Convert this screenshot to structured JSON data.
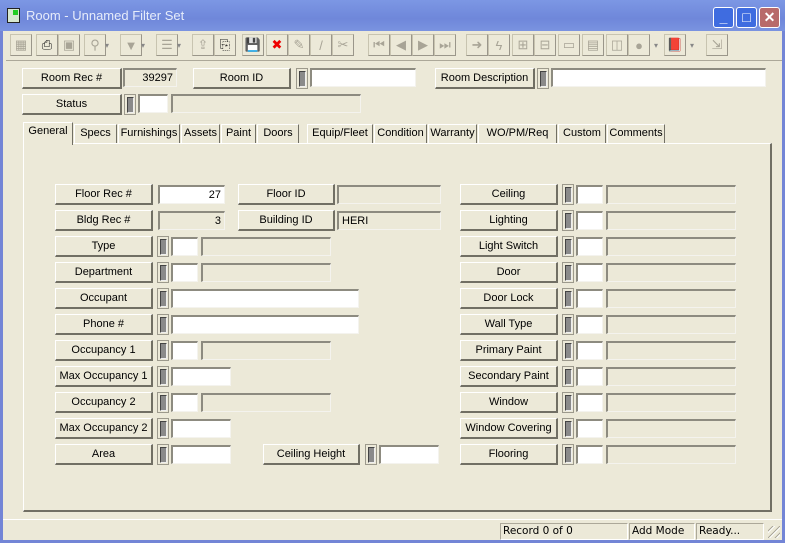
{
  "window": {
    "title": "Room - Unnamed Filter Set",
    "controls": {
      "minimize": "_",
      "maximize": "□",
      "close": "✕"
    }
  },
  "toolbar": {
    "buttons": [
      {
        "name": "select-area",
        "glyph": "▦",
        "enabled": false
      },
      {
        "name": "print",
        "glyph": "⎙",
        "enabled": true
      },
      {
        "name": "print-preview",
        "glyph": "▣",
        "enabled": false
      },
      {
        "name": "query",
        "glyph": "⚲",
        "enabled": false
      },
      {
        "name": "filter",
        "glyph": "▼",
        "enabled": false
      },
      {
        "name": "report",
        "glyph": "☰",
        "enabled": false
      },
      {
        "name": "export",
        "glyph": "⇪",
        "enabled": false
      },
      {
        "name": "new-document",
        "glyph": "⎘",
        "enabled": true
      },
      {
        "name": "save",
        "glyph": "💾",
        "enabled": true
      },
      {
        "name": "delete",
        "glyph": "✖",
        "enabled": true
      },
      {
        "name": "attach",
        "glyph": "✎",
        "enabled": false
      },
      {
        "name": "edit",
        "glyph": "/",
        "enabled": false
      },
      {
        "name": "cut",
        "glyph": "✂",
        "enabled": false
      },
      {
        "name": "first-record",
        "glyph": "⏮",
        "enabled": false
      },
      {
        "name": "previous-record",
        "glyph": "◀",
        "enabled": false
      },
      {
        "name": "next-record",
        "glyph": "▶",
        "enabled": false
      },
      {
        "name": "last-record",
        "glyph": "⏭",
        "enabled": false
      },
      {
        "name": "go-to",
        "glyph": "➜",
        "enabled": false
      },
      {
        "name": "lightning",
        "glyph": "ϟ",
        "enabled": false
      },
      {
        "name": "tree-view",
        "glyph": "⊞",
        "enabled": false
      },
      {
        "name": "hierarchy",
        "glyph": "⊟",
        "enabled": false
      },
      {
        "name": "form-view",
        "glyph": "▭",
        "enabled": false
      },
      {
        "name": "calendar",
        "glyph": "▤",
        "enabled": false
      },
      {
        "name": "chart",
        "glyph": "◫",
        "enabled": false
      },
      {
        "name": "comment",
        "glyph": "●",
        "enabled": false
      },
      {
        "name": "help-book",
        "glyph": "📕",
        "enabled": true
      },
      {
        "name": "exit",
        "glyph": "⇲",
        "enabled": false
      }
    ]
  },
  "header": {
    "room_rec": {
      "label": "Room Rec #",
      "value": "39297"
    },
    "room_id": {
      "label": "Room ID",
      "value": ""
    },
    "room_description": {
      "label": "Room Description",
      "value": ""
    },
    "status": {
      "label": "Status",
      "code": "",
      "description": ""
    }
  },
  "tabs": [
    {
      "label": "General",
      "active": true
    },
    {
      "label": "Specs"
    },
    {
      "label": "Furnishings"
    },
    {
      "label": "Assets"
    },
    {
      "label": "Paint"
    },
    {
      "label": "Doors"
    },
    {
      "label": "Equip/Fleet"
    },
    {
      "label": "Condition"
    },
    {
      "label": "Warranty"
    },
    {
      "label": "WO/PM/Req"
    },
    {
      "label": "Custom"
    },
    {
      "label": "Comments"
    }
  ],
  "general": {
    "floor_rec": {
      "label": "Floor Rec #",
      "value": "27"
    },
    "floor_id": {
      "label": "Floor ID",
      "value": ""
    },
    "bldg_rec": {
      "label": "Bldg Rec #",
      "value": "3"
    },
    "building_id": {
      "label": "Building ID",
      "value": "HERI"
    },
    "type": {
      "label": "Type",
      "code": "",
      "description": ""
    },
    "department": {
      "label": "Department",
      "code": "",
      "description": ""
    },
    "occupant": {
      "label": "Occupant",
      "value": ""
    },
    "phone": {
      "label": "Phone #",
      "value": ""
    },
    "occupancy1": {
      "label": "Occupancy 1",
      "code": "",
      "description": ""
    },
    "max_occupancy1": {
      "label": "Max Occupancy 1",
      "value": ""
    },
    "occupancy2": {
      "label": "Occupancy 2",
      "code": "",
      "description": ""
    },
    "max_occupancy2": {
      "label": "Max Occupancy 2",
      "value": ""
    },
    "area": {
      "label": "Area",
      "value": ""
    },
    "ceiling_height": {
      "label": "Ceiling Height",
      "value": ""
    },
    "right_fields": [
      {
        "label": "Ceiling",
        "code": "",
        "description": ""
      },
      {
        "label": "Lighting",
        "code": "",
        "description": ""
      },
      {
        "label": "Light Switch",
        "code": "",
        "description": ""
      },
      {
        "label": "Door",
        "code": "",
        "description": ""
      },
      {
        "label": "Door Lock",
        "code": "",
        "description": ""
      },
      {
        "label": "Wall Type",
        "code": "",
        "description": ""
      },
      {
        "label": "Primary Paint",
        "code": "",
        "description": ""
      },
      {
        "label": "Secondary Paint",
        "code": "",
        "description": ""
      },
      {
        "label": "Window",
        "code": "",
        "description": ""
      },
      {
        "label": "Window Covering",
        "code": "",
        "description": ""
      },
      {
        "label": "Flooring",
        "code": "",
        "description": ""
      }
    ]
  },
  "statusbar": {
    "record": "Record 0 of 0",
    "mode": "Add Mode",
    "state": "Ready..."
  }
}
